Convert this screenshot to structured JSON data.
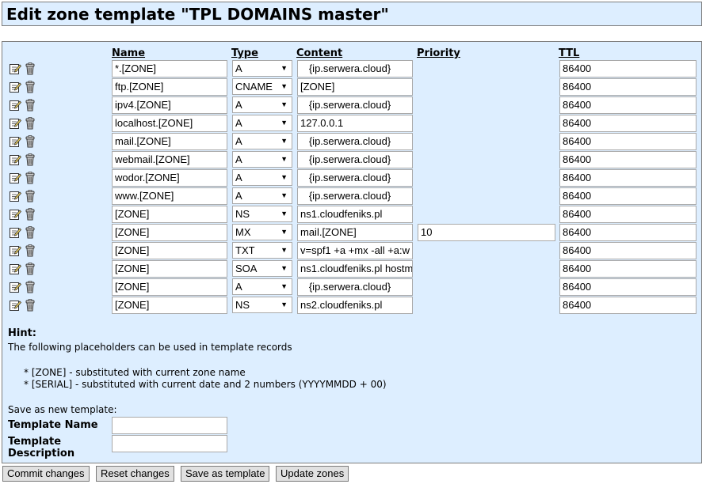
{
  "page": {
    "title": "Edit zone template \"TPL DOMAINS master\""
  },
  "table": {
    "headers": {
      "name": "Name",
      "type": "Type",
      "content": "Content",
      "priority": "Priority",
      "ttl": "TTL"
    },
    "records": [
      {
        "name": "*.[ZONE]",
        "type": "A",
        "content": "   {ip.serwera.cloud}",
        "priority": "",
        "ttl": "86400"
      },
      {
        "name": "ftp.[ZONE]",
        "type": "CNAME",
        "content": "[ZONE]",
        "priority": "",
        "ttl": "86400"
      },
      {
        "name": "ipv4.[ZONE]",
        "type": "A",
        "content": "   {ip.serwera.cloud}",
        "priority": "",
        "ttl": "86400"
      },
      {
        "name": "localhost.[ZONE]",
        "type": "A",
        "content": "127.0.0.1",
        "priority": "",
        "ttl": "86400"
      },
      {
        "name": "mail.[ZONE]",
        "type": "A",
        "content": "   {ip.serwera.cloud}",
        "priority": "",
        "ttl": "86400"
      },
      {
        "name": "webmail.[ZONE]",
        "type": "A",
        "content": "   {ip.serwera.cloud}",
        "priority": "",
        "ttl": "86400"
      },
      {
        "name": "wodor.[ZONE]",
        "type": "A",
        "content": "   {ip.serwera.cloud}",
        "priority": "",
        "ttl": "86400"
      },
      {
        "name": "www.[ZONE]",
        "type": "A",
        "content": "   {ip.serwera.cloud}",
        "priority": "",
        "ttl": "86400"
      },
      {
        "name": "[ZONE]",
        "type": "NS",
        "content": "ns1.cloudfeniks.pl",
        "priority": "",
        "ttl": "86400"
      },
      {
        "name": "[ZONE]",
        "type": "MX",
        "content": "mail.[ZONE]",
        "priority": "10",
        "ttl": "86400"
      },
      {
        "name": "[ZONE]",
        "type": "TXT",
        "content": "v=spf1 +a +mx -all +a:w",
        "priority": "",
        "ttl": "86400"
      },
      {
        "name": "[ZONE]",
        "type": "SOA",
        "content": "ns1.cloudfeniks.pl hostm",
        "priority": "",
        "ttl": "86400"
      },
      {
        "name": "[ZONE]",
        "type": "A",
        "content": "   {ip.serwera.cloud}",
        "priority": "",
        "ttl": "86400"
      },
      {
        "name": "[ZONE]",
        "type": "NS",
        "content": "ns2.cloudfeniks.pl",
        "priority": "",
        "ttl": "86400"
      }
    ],
    "icons": {
      "edit": "edit-icon",
      "delete": "trash-icon"
    }
  },
  "hint": {
    "title": "Hint:",
    "intro": "The following placeholders can be used in template records",
    "items": [
      "* [ZONE] - substituted with current zone name",
      "* [SERIAL] - substituted with current date and 2 numbers (YYYYMMDD + 00)"
    ]
  },
  "save_template": {
    "heading": "Save as new template:",
    "name_label": "Template Name",
    "name_value": "",
    "description_label": "Template Description",
    "description_value": ""
  },
  "buttons": {
    "commit": "Commit changes",
    "reset": "Reset changes",
    "save_template": "Save as template",
    "update_zones": "Update zones"
  },
  "colors": {
    "panel_bg": "#ddeeff",
    "border": "#7d7d7d"
  }
}
